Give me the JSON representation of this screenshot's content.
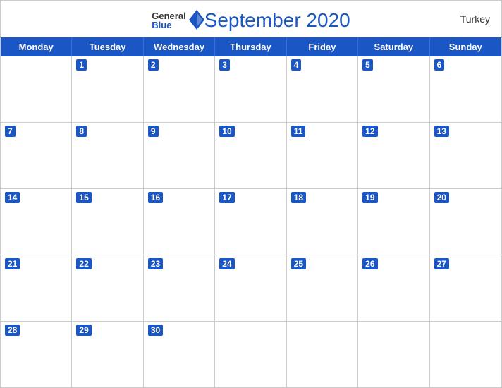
{
  "header": {
    "title": "September 2020",
    "country": "Turkey",
    "logo_general": "General",
    "logo_blue": "Blue"
  },
  "days": {
    "headers": [
      "Monday",
      "Tuesday",
      "Wednesday",
      "Thursday",
      "Friday",
      "Saturday",
      "Sunday"
    ]
  },
  "weeks": [
    [
      null,
      1,
      2,
      3,
      4,
      5,
      6
    ],
    [
      7,
      8,
      9,
      10,
      11,
      12,
      13
    ],
    [
      14,
      15,
      16,
      17,
      18,
      19,
      20
    ],
    [
      21,
      22,
      23,
      24,
      25,
      26,
      27
    ],
    [
      28,
      29,
      30,
      null,
      null,
      null,
      null
    ]
  ]
}
